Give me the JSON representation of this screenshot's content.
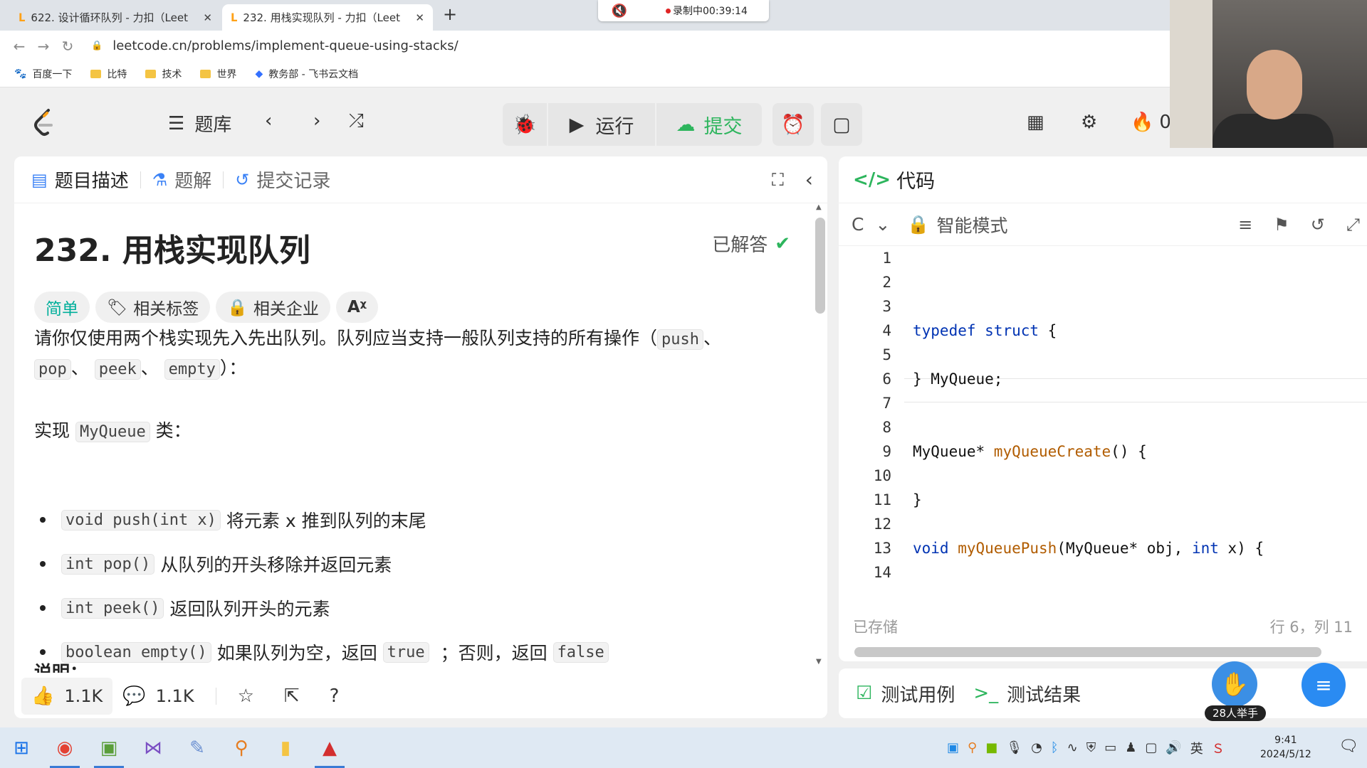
{
  "browser": {
    "tabs": [
      {
        "title": "622. 设计循环队列 - 力扣（Leet",
        "active": false
      },
      {
        "title": "232. 用栈实现队列 - 力扣（Leet",
        "active": true
      }
    ],
    "new_tab_icon": "+",
    "recording": {
      "label": "录制中00:39:14"
    },
    "url": "leetcode.cn/problems/implement-queue-using-stacks/",
    "bookmarks": [
      "百度一下",
      "比特",
      "技术",
      "世界",
      "教务部 - 飞书云文档"
    ]
  },
  "toolbar": {
    "problem_list": "题库",
    "run": "运行",
    "submit": "提交",
    "points_count": "0"
  },
  "left_panel": {
    "tabs": [
      "题目描述",
      "题解",
      "提交记录"
    ],
    "title": "232. 用栈实现队列",
    "solved_label": "已解答",
    "tags": [
      "简单",
      "相关标签",
      "相关企业"
    ],
    "intro_text": "请你仅使用两个栈实现先入先出队列。队列应当支持一般队列支持的所有操作（",
    "intro_codes": [
      "push",
      "pop",
      "peek",
      "empty"
    ],
    "intro_seps": [
      "、",
      "、",
      "、",
      "）："
    ],
    "impl_prefix": "实现",
    "impl_code": "MyQueue",
    "impl_suffix": "类：",
    "bullets": [
      {
        "code": "void push(int x)",
        "text": "将元素 x 推到队列的末尾"
      },
      {
        "code": "int pop()",
        "text": "从队列的开头移除并返回元素"
      },
      {
        "code": "int peek()",
        "text": "返回队列开头的元素"
      },
      {
        "code": "boolean empty()",
        "text": "如果队列为空，返回",
        "code2": "true",
        "text2": "；否则，返回",
        "code3": "false"
      }
    ],
    "partial_heading": "说明：",
    "footer": {
      "likes": "1.1K",
      "comments": "1.1K"
    }
  },
  "code_panel": {
    "title": "代码",
    "language": "C",
    "mode": "智能模式",
    "lines": [
      {
        "n": "1",
        "code": ""
      },
      {
        "n": "2",
        "code": ""
      },
      {
        "n": "3",
        "code": ""
      },
      {
        "n": "4",
        "code": "typedef struct {"
      },
      {
        "n": "5",
        "code": ""
      },
      {
        "n": "6",
        "code": "} MyQueue;"
      },
      {
        "n": "7",
        "code": ""
      },
      {
        "n": "8",
        "code": ""
      },
      {
        "n": "9",
        "code": "MyQueue* myQueueCreate() {"
      },
      {
        "n": "10",
        "code": ""
      },
      {
        "n": "11",
        "code": "}"
      },
      {
        "n": "12",
        "code": ""
      },
      {
        "n": "13",
        "code": "void myQueuePush(MyQueue* obj, int x) {"
      },
      {
        "n": "14",
        "code": ""
      }
    ],
    "saved_label": "已存储",
    "cursor_pos": "行 6，列 11"
  },
  "test_panel": {
    "tabs": [
      "测试用例",
      "测试结果"
    ],
    "raise_hand_label": "28人举手"
  },
  "taskbar": {
    "time": "9:41",
    "date": "2024/5/12"
  }
}
